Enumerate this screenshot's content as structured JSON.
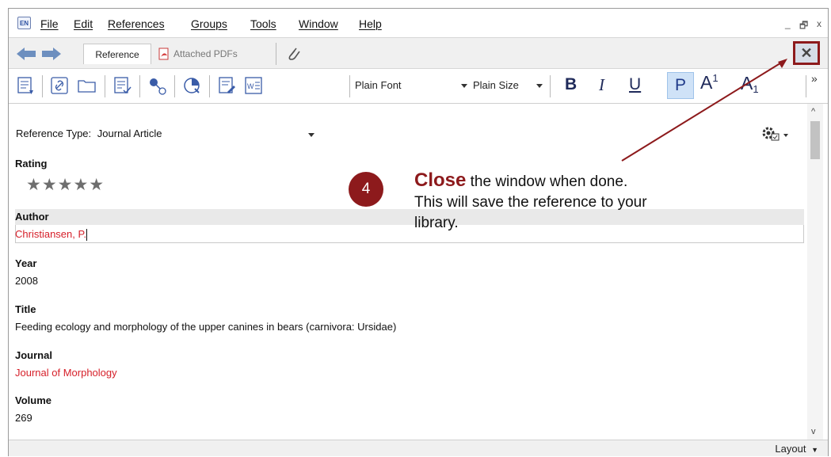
{
  "app": {
    "logo_text": "EN",
    "menu": [
      "File",
      "Edit",
      "References",
      "Groups",
      "Tools",
      "Window",
      "Help"
    ],
    "window_controls": {
      "minimize": "_",
      "restore": "🗗",
      "close": "x"
    }
  },
  "tabs": {
    "reference_label": "Reference",
    "attached_pdfs_label": "Attached PDFs",
    "close_symbol": "✕"
  },
  "toolbar": {
    "font": "Plain Font",
    "size": "Plain Size",
    "bold": "B",
    "italic": "I",
    "underline": "U",
    "plain": "P",
    "superscript_base": "A",
    "superscript_mark": "1",
    "subscript_base": "A",
    "subscript_mark": "1",
    "overflow": "»"
  },
  "reference": {
    "type_label": "Reference Type:",
    "type_value": "Journal Article",
    "rating_label": "Rating",
    "rating_stars": "★★★★★",
    "rating_value": 0,
    "fields": [
      {
        "label": "Author",
        "value": "Christiansen, P."
      },
      {
        "label": "Year",
        "value": "2008"
      },
      {
        "label": "Title",
        "value": "Feeding ecology and morphology of the upper canines in bears (carnivora: Ursidae)"
      },
      {
        "label": "Journal",
        "value": "Journal of Morphology"
      },
      {
        "label": "Volume",
        "value": "269"
      }
    ]
  },
  "status": {
    "layout_label": "Layout"
  },
  "callout": {
    "step": "4",
    "emphasis": "Close",
    "line1": " the window when done.",
    "line2": "This will save the reference to your",
    "line3": "library."
  },
  "colors": {
    "accent": "#8d1a1c",
    "author_red": "#d6202a",
    "selection_blue": "#cfe2f7"
  }
}
